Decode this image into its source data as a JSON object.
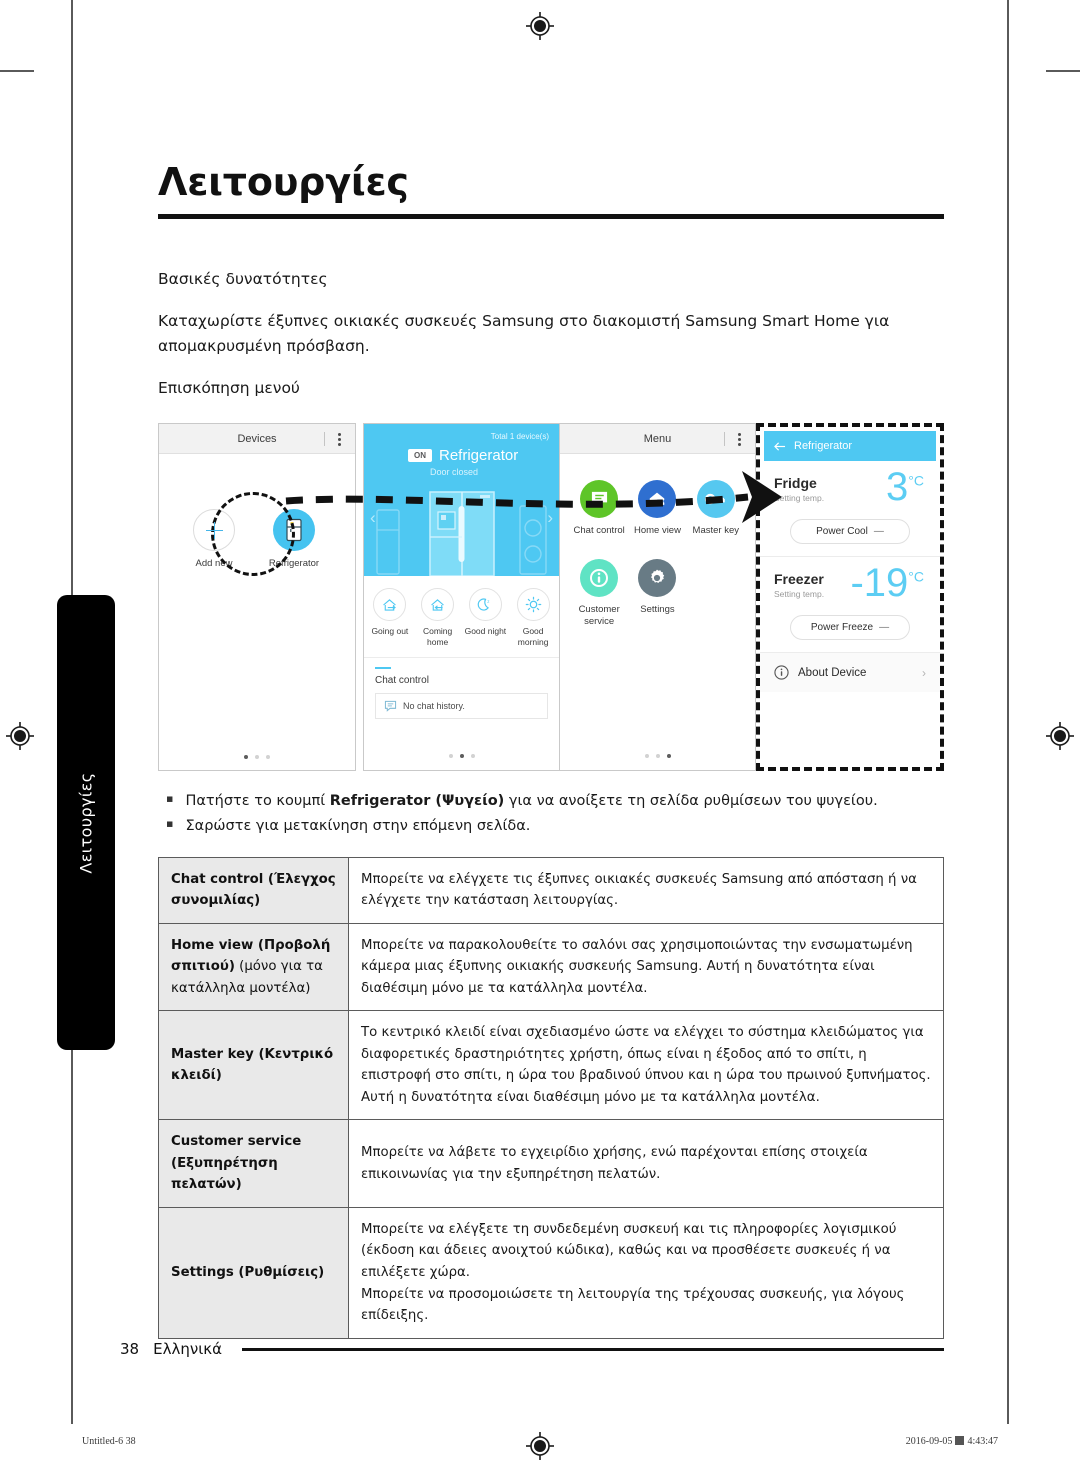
{
  "page": {
    "title": "Λειτουργίες",
    "side_tab_label": "Λειτουργίες",
    "footer_page_number": "38",
    "footer_language": "Ελληνικά"
  },
  "intro": {
    "heading": "Βασικές δυνατότητες",
    "paragraph": "Καταχωρίστε έξυπνες οικιακές συσκευές Samsung στο διακομιστή Samsung Smart Home για απομακρυσμένη πρόσβαση.",
    "subheading": "Επισκόπηση μενού"
  },
  "screens": {
    "devices": {
      "titlebar": "Devices",
      "add_new_label": "Add new",
      "refrigerator_label": "Refrigerator",
      "page_dots": 3,
      "active_dot": 0
    },
    "device_hero": {
      "total_devices": "Total 1 device(s)",
      "on_badge": "ON",
      "device_name": "Refrigerator",
      "device_status": "Door closed",
      "modes": [
        {
          "label": "Going out",
          "icon": "house-arrow-out-icon"
        },
        {
          "label": "Coming home",
          "icon": "house-arrow-in-icon"
        },
        {
          "label": "Good night",
          "icon": "moon-icon"
        },
        {
          "label": "Good morning",
          "icon": "sun-icon"
        }
      ],
      "chat_section_title": "Chat control",
      "chat_empty_text": "No chat history.",
      "page_dots": 3,
      "active_dot": 1
    },
    "menu": {
      "titlebar": "Menu",
      "items": [
        {
          "label": "Chat control",
          "icon": "speech-bubble-icon",
          "color": "#5ec528"
        },
        {
          "label": "Home view",
          "icon": "house-camera-icon",
          "color": "#2f6fd0"
        },
        {
          "label": "Master key",
          "icon": "key-icon",
          "color": "#56c8f0"
        },
        {
          "label": "Customer service",
          "icon": "info-icon",
          "color": "#5fe3c4"
        },
        {
          "label": "Settings",
          "icon": "gear-icon",
          "color": "#687b85"
        }
      ],
      "page_dots": 3,
      "active_dot": 2
    },
    "fridge_settings": {
      "titlebar": "Refrigerator",
      "back_icon": "back-arrow-icon",
      "fridge": {
        "name": "Fridge",
        "sub": "Setting temp.",
        "value": "3",
        "unit": "°C",
        "button": "Power Cool",
        "button_state": "—"
      },
      "freezer": {
        "name": "Freezer",
        "sub": "Setting temp.",
        "value": "-19",
        "unit": "°C",
        "button": "Power Freeze",
        "button_state": "—"
      },
      "about": "About Device"
    }
  },
  "bullets": [
    {
      "pre": "Πατήστε το κουμπί ",
      "bold": "Refrigerator (Ψυγείο)",
      "post": " για να ανοίξετε τη σελίδα ρυθμίσεων του ψυγείου."
    },
    {
      "pre": "Σαρώστε για μετακίνηση στην επόμενη σελίδα.",
      "bold": "",
      "post": ""
    }
  ],
  "table": {
    "rows": [
      {
        "key_bold": "Chat control (Έλεγχος συνομιλίας)",
        "key_norm": "",
        "value": "Μπορείτε να ελέγχετε τις έξυπνες οικιακές συσκευές Samsung από απόσταση ή να ελέγχετε την κατάσταση λειτουργίας."
      },
      {
        "key_bold": "Home view (Προβολή σπιτιού)",
        "key_norm": " (μόνο για τα κατάλληλα μοντέλα)",
        "value": "Μπορείτε να παρακολουθείτε το σαλόνι σας χρησιμοποιώντας την ενσωματωμένη κάμερα μιας έξυπνης οικιακής συσκευής Samsung. Αυτή η δυνατότητα είναι διαθέσιμη μόνο με τα κατάλληλα μοντέλα."
      },
      {
        "key_bold": "Master key (Κεντρικό κλειδί)",
        "key_norm": "",
        "value": "Το κεντρικό κλειδί είναι σχεδιασμένο ώστε να ελέγχει το σύστημα κλειδώματος για διαφορετικές δραστηριότητες χρήστη, όπως είναι η έξοδος από το σπίτι, η επιστροφή στο σπίτι, η ώρα του βραδινού ύπνου και η ώρα του πρωινού ξυπνήματος. Αυτή η δυνατότητα είναι διαθέσιμη μόνο με τα κατάλληλα μοντέλα."
      },
      {
        "key_bold": "Customer service (Εξυπηρέτηση πελατών)",
        "key_norm": "",
        "value": "Μπορείτε να λάβετε το εγχειρίδιο χρήσης, ενώ παρέχονται επίσης στοιχεία επικοινωνίας για την εξυπηρέτηση πελατών."
      },
      {
        "key_bold": "Settings (Ρυθμίσεις)",
        "key_norm": "",
        "value": "Μπορείτε να ελέγξετε τη συνδεδεμένη συσκευή και τις πληροφορίες λογισμικού (έκδοση και άδειες ανοιχτού κώδικα), καθώς και να προσθέσετε συσκευές ή να επιλέξετε χώρα.\nΜπορείτε να προσομοιώσετε τη λειτουργία της τρέχουσας συσκευής, για λόγους επίδειξης."
      }
    ]
  },
  "print_slug": {
    "left": "Untitled-6   38",
    "right_date": "2016-09-05",
    "right_time": "4:43:47"
  }
}
